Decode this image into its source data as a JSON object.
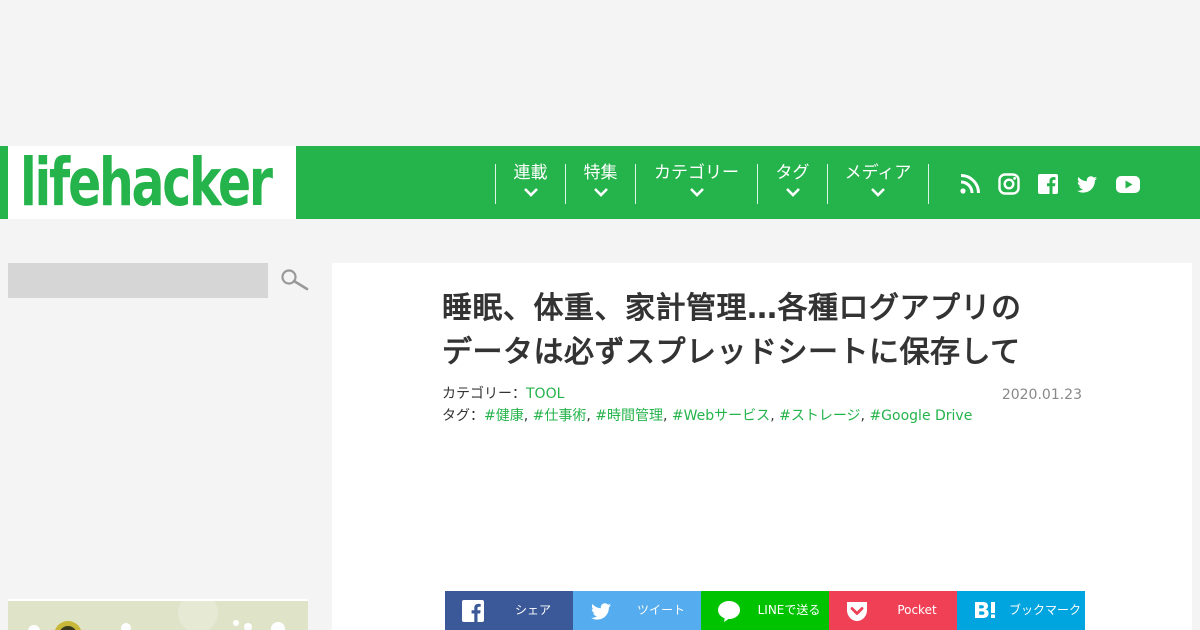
{
  "logo": {
    "text": "lifehacker"
  },
  "nav": {
    "items": [
      {
        "label": "連載"
      },
      {
        "label": "特集"
      },
      {
        "label": "カテゴリー"
      },
      {
        "label": "タグ"
      },
      {
        "label": "メディア"
      }
    ],
    "social_icons": [
      "rss-icon",
      "instagram-icon",
      "facebook-icon",
      "twitter-icon",
      "youtube-icon"
    ]
  },
  "sidebar": {
    "search": {
      "value": "",
      "placeholder": ""
    }
  },
  "article": {
    "title_line1": "睡眠、体重、家計管理…各種ログアプリの",
    "title_line2": "データは必ずスプレッドシートに保存して",
    "category_label": "カテゴリー：",
    "category": "TOOL",
    "tags_label": "タグ：",
    "tags": [
      "#健康",
      "#仕事術",
      "#時間管理",
      "#Webサービス",
      "#ストレージ",
      "#Google Drive"
    ],
    "tag_separator": ",",
    "date": "2020.01.23"
  },
  "share": {
    "facebook": "シェア",
    "twitter": "ツイート",
    "line": "LINEで送る",
    "pocket": "Pocket",
    "hatena": "ブックマーク"
  },
  "colors": {
    "brand": "#25b34b",
    "facebook": "#3b5998",
    "twitter": "#55acee",
    "line": "#00c300",
    "pocket": "#ef4056",
    "hatena": "#00a4de"
  }
}
